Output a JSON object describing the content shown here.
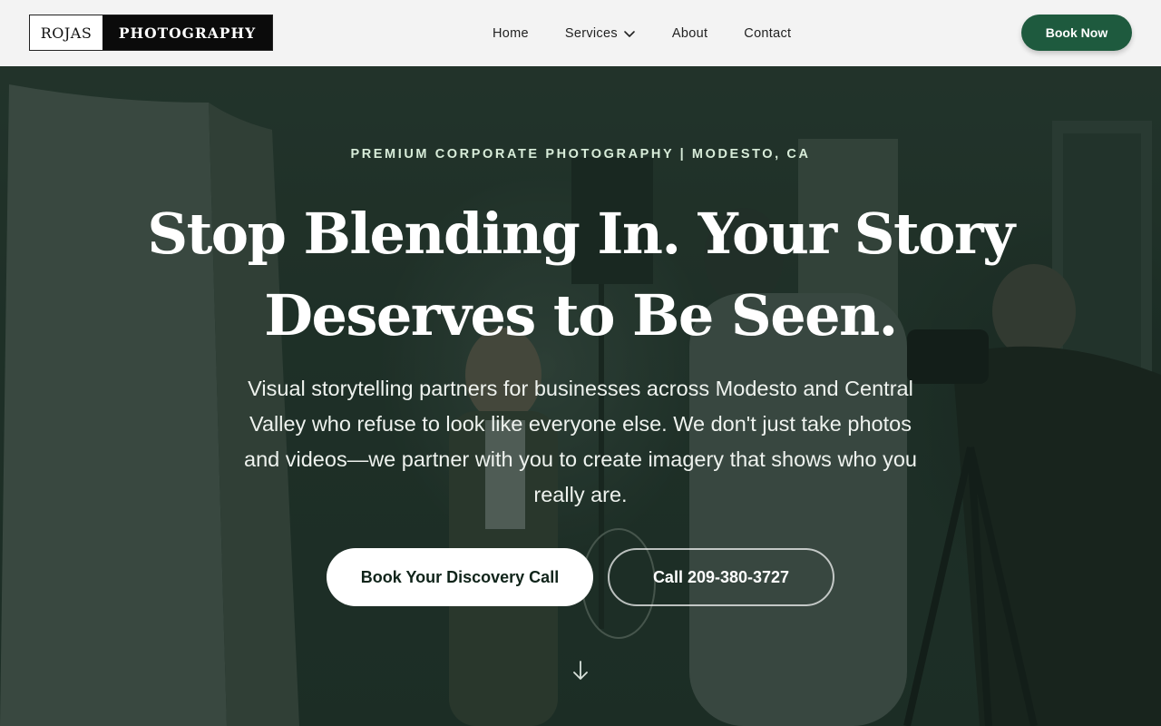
{
  "brand": {
    "logo_left": "ROJAS",
    "logo_right": "PHOTOGRAPHY"
  },
  "nav": {
    "items": [
      {
        "label": "Home"
      },
      {
        "label": "Services",
        "icon": "chevron-down-icon"
      },
      {
        "label": "About"
      },
      {
        "label": "Contact"
      }
    ],
    "book_now": "Book Now"
  },
  "hero": {
    "eyebrow": "PREMIUM CORPORATE PHOTOGRAPHY | MODESTO, CA",
    "headline": "Stop Blending In. Your Story Deserves to Be Seen.",
    "subcopy": "Visual storytelling partners for businesses across Modesto and Central Valley who refuse to look like everyone else. We don't just take photos and videos—we partner with you to create imagery that shows who you really are.",
    "cta_primary": "Book Your Discovery Call",
    "cta_secondary": "Call 209-380-3727",
    "scroll_icon": "arrow-down-icon"
  },
  "colors": {
    "header_bg": "#f3f3f3",
    "accent_green": "#1e5a3e",
    "overlay": "#16281f",
    "eyebrow": "#d8ecd9"
  }
}
